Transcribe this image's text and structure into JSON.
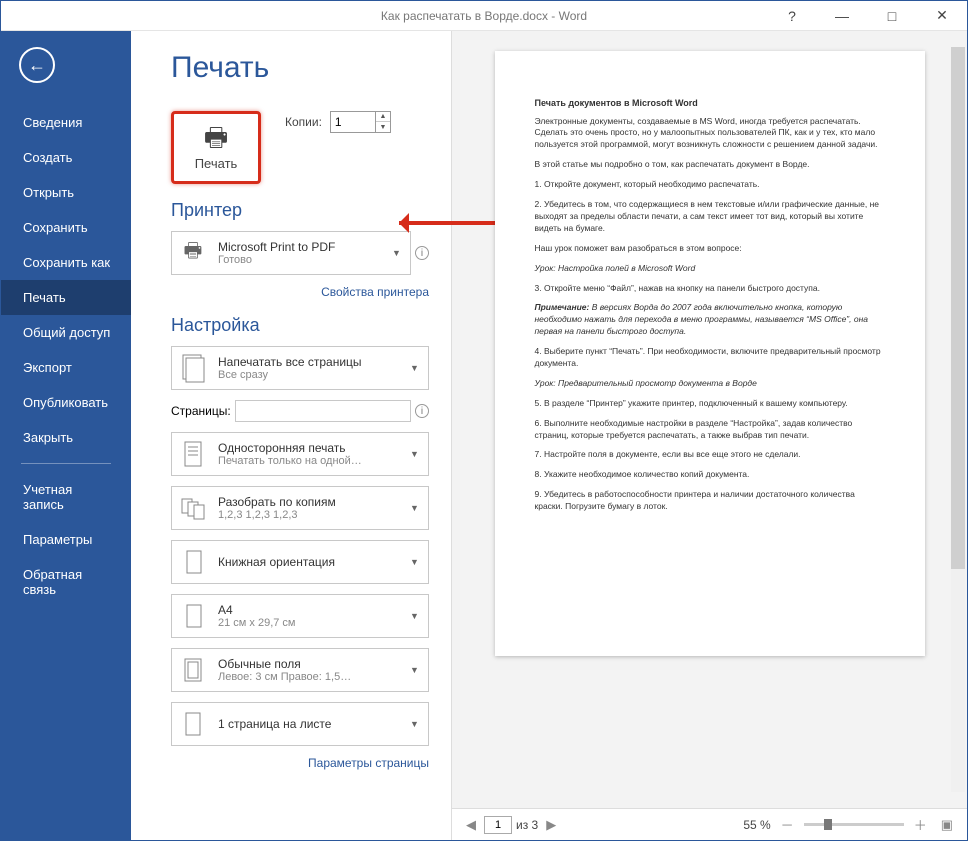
{
  "titlebar": {
    "title": "Как распечатать в Ворде.docx - Word",
    "help": "?",
    "min": "—",
    "max": "□",
    "close": "✕"
  },
  "sidebar": {
    "items": [
      "Сведения",
      "Создать",
      "Открыть",
      "Сохранить",
      "Сохранить как",
      "Печать",
      "Общий доступ",
      "Экспорт",
      "Опубликовать",
      "Закрыть"
    ],
    "bottom": [
      "Учетная запись",
      "Параметры",
      "Обратная связь"
    ]
  },
  "page": {
    "title": "Печать"
  },
  "print": {
    "button_label": "Печать",
    "copies_label": "Копии:",
    "copies_value": "1"
  },
  "printer": {
    "section": "Принтер",
    "name": "Microsoft Print to PDF",
    "status": "Готово",
    "properties": "Свойства принтера"
  },
  "settings": {
    "section": "Настройка",
    "items": [
      {
        "main": "Напечатать все страницы",
        "sub": "Все сразу"
      }
    ],
    "pages_label": "Страницы:",
    "pages_value": "",
    "items2": [
      {
        "main": "Односторонняя печать",
        "sub": "Печатать только на одной…"
      },
      {
        "main": "Разобрать по копиям",
        "sub": "1,2,3   1,2,3   1,2,3"
      },
      {
        "main": "Книжная ориентация",
        "sub": ""
      },
      {
        "main": "A4",
        "sub": "21 см x 29,7 см"
      },
      {
        "main": "Обычные поля",
        "sub": "Левое:  3 см   Правое:  1,5…"
      },
      {
        "main": "1 страница на листе",
        "sub": ""
      }
    ],
    "page_setup": "Параметры страницы"
  },
  "preview": {
    "doc_heading": "Печать документов в Microsoft Word",
    "paragraphs": [
      "Электронные документы, создаваемые в MS Word, иногда требуется распечатать. Сделать это очень просто, но у малоопытных пользователей ПК, как и у тех, кто мало пользуется этой программой, могут возникнуть сложности с решением данной задачи.",
      "В этой статье мы подробно о том, как распечатать документ в Ворде.",
      "1. Откройте документ, который необходимо распечатать.",
      "2. Убедитесь в том, что содержащиеся в нем текстовые и/или графические данные, не выходят за пределы области печати, а сам текст имеет тот вид, который вы хотите видеть на бумаге.",
      "Наш урок поможет вам разобраться в этом вопросе:"
    ],
    "lesson1": "Урок: Настройка полей в Microsoft Word",
    "p3": "3. Откройте меню “Файл”, нажав на кнопку на панели быстрого доступа.",
    "note": "Примечание: В версиях Ворда до 2007 года включительно кнопка, которую необходимо нажать для перехода в меню программы, называется “MS Office”, она первая на панели быстрого доступа.",
    "note_label": "Примечание:",
    "p4": "4. Выберите пункт “Печать”. При необходимости, включите предварительный просмотр документа.",
    "lesson2": "Урок: Предварительный просмотр документа в Ворде",
    "p5": "5. В разделе “Принтер” укажите принтер, подключенный к вашему компьютеру.",
    "p6": "6. Выполните необходимые настройки в разделе “Настройка”, задав количество страниц, которые требуется распечатать, а также выбрав тип печати.",
    "p7": "7. Настройте поля в документе, если вы все еще этого не сделали.",
    "p8": "8. Укажите необходимое количество копий документа.",
    "p9": "9. Убедитесь в работоспособности принтера и наличии достаточного количества краски. Погрузите бумагу в лоток.",
    "page_current": "1",
    "page_total_label": "из 3",
    "zoom": "55 %"
  }
}
